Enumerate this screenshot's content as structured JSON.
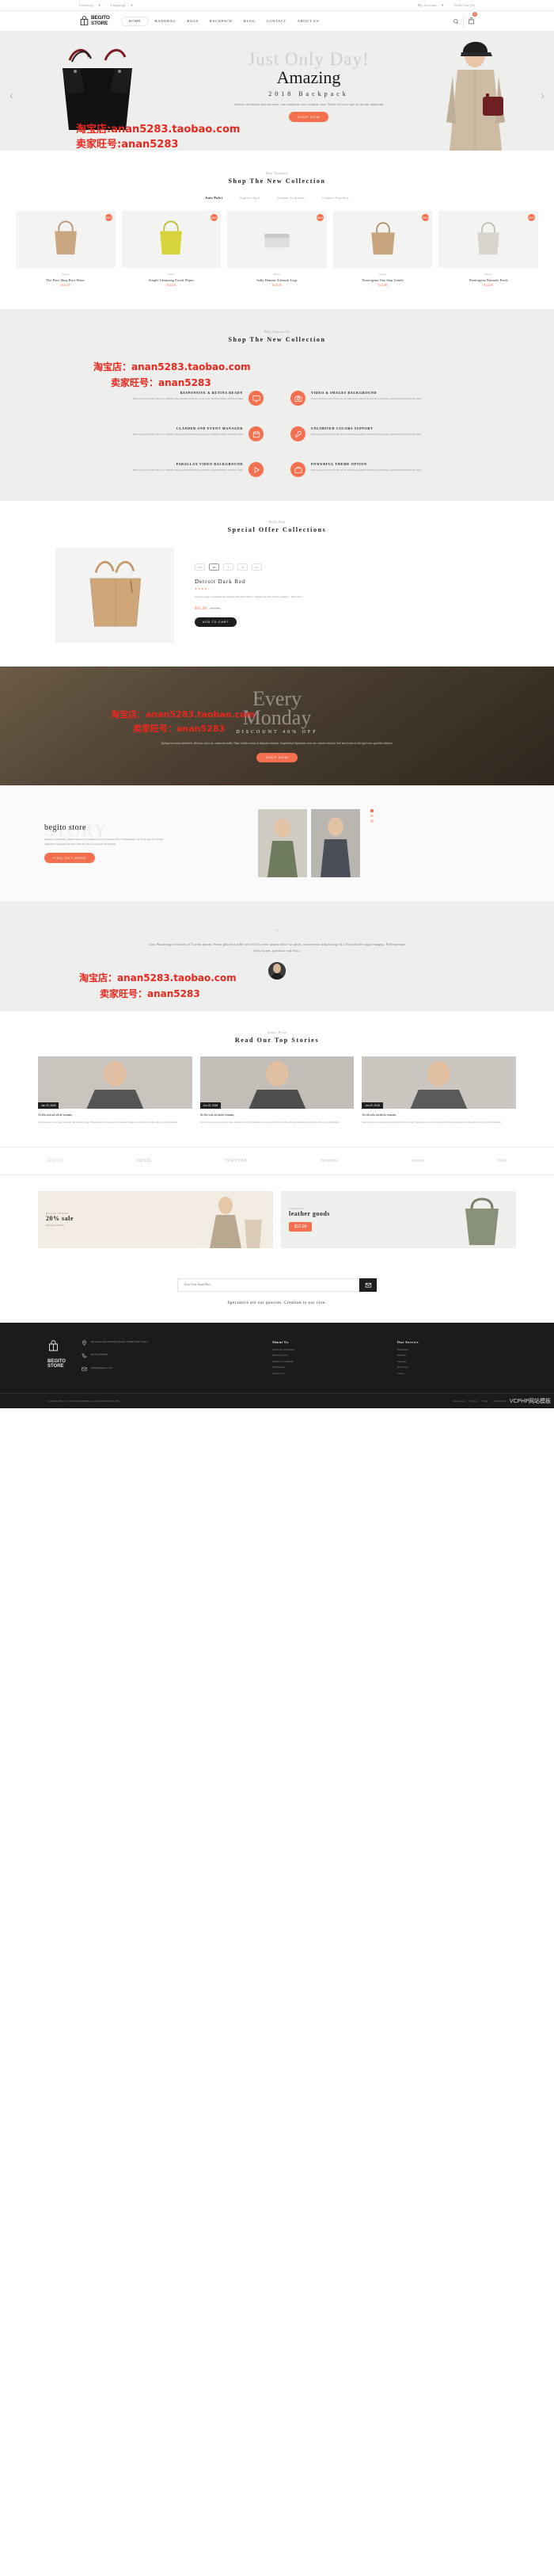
{
  "topbar": {
    "currency": "Currency",
    "language": "Language",
    "account": "My Account",
    "wishlist": "Wish List (0)"
  },
  "header": {
    "logo_line1": "BEGITO",
    "logo_line2": "STORE",
    "nav": [
      {
        "label": "HOME",
        "active": true
      },
      {
        "label": "HANDBAG",
        "active": false
      },
      {
        "label": "BAGS",
        "active": false
      },
      {
        "label": "BACKPACK",
        "active": false
      },
      {
        "label": "BLOG",
        "active": false
      },
      {
        "label": "CONTACT",
        "active": false
      },
      {
        "label": "ABOUT US",
        "active": false
      }
    ],
    "cart_count": "0"
  },
  "hero": {
    "line1": "Just Only Day!",
    "line2": "Amazing",
    "line3": "2018  Backpack",
    "desc": "Aenean vestibulum pretium enim, non commodo arcu volutpat vitae. Nulla vel lacus eget ex dictum dignissim",
    "button": "SHOP NOW",
    "prev": "‹",
    "next": "›"
  },
  "products": {
    "subtitle": "New Products",
    "title": "Shop The New Collection",
    "filters": [
      {
        "label": "Ante Pulvi",
        "active": true
      },
      {
        "label": "Sagittis Eget",
        "active": false
      },
      {
        "label": "Semper Vulputate",
        "active": false
      },
      {
        "label": "Congue Faucibus",
        "active": false
      }
    ],
    "items": [
      {
        "badge": "SALE",
        "category": "Beatae",
        "name": "The Face Shop Rice Water",
        "price": "$122.00"
      },
      {
        "badge": "SALE",
        "category": "Beatae",
        "name": "Simple Cleansing Facial Wipes",
        "price": "$122.00"
      },
      {
        "badge": "SALE",
        "category": "Beatae",
        "name": "Sally Hansen Airbrush Legs",
        "price": "$122.00"
      },
      {
        "badge": "SALE",
        "category": "Beatae",
        "name": "Neutrogena One Step Gentle",
        "price": "$122.00"
      },
      {
        "badge": "SALE",
        "category": "Beatae",
        "name": "Neutrogena Naturals Fresh",
        "price": "$122.00"
      }
    ]
  },
  "why": {
    "subtitle": "Why Choose Us",
    "title": "Shop The New Collection",
    "desc_common": "Fusce gravida tortor felis. Ac dictum risus sagittis id morbi porm justo eleifend libero ultricies amet",
    "features": [
      {
        "title": "RESPONSIVE & RETINA READY",
        "icon": "monitor-icon"
      },
      {
        "title": "VIDEO & IMAGES BACKGROUND",
        "icon": "camera-icon"
      },
      {
        "title": "CLANDER AND EVENT MANAGER",
        "icon": "calendar-icon"
      },
      {
        "title": "UNLIMITED COLORS SUPPORT",
        "icon": "wrench-icon"
      },
      {
        "title": "PARALLAX VIDEO BACKGROUND",
        "icon": "play-icon"
      },
      {
        "title": "POWERFUL THEME OPTION",
        "icon": "briefcase-icon"
      }
    ]
  },
  "offer": {
    "subtitle": "Hello Day",
    "title": "Special Offer Collections",
    "swatches": [
      {
        "label": "XXS",
        "active": false
      },
      {
        "label": "XS",
        "active": true
      },
      {
        "label": "S",
        "active": false
      },
      {
        "label": "M",
        "active": false
      },
      {
        "label": "XL",
        "active": false
      }
    ],
    "name": "Detroit Dark Red",
    "stars": "★★★★☆",
    "desc": "Cupid a purus venenatis dui sem $42.00 etiam that 's \"malesu lul sem fr416 consequ\" , dolor mi's...",
    "price": "$95.00",
    "old_price": "$125.00",
    "button": "ADD TO CART"
  },
  "discount": {
    "line1": "Every",
    "line2": "Monday",
    "headline": "DISCOUNT 40% OFF",
    "paragraph": "Quisque ut massa hendrerit, efficitur tortor eu, commodo nulla. Nam sodales metus in aliquam tristique. Suspendisse dignissim risus nec rutrum vehicula. Sed non lorem ut elit eget tortor gravida ultricies.",
    "button": "SHOP NOW"
  },
  "story": {
    "ghost": "STORY",
    "heading": "begito store",
    "paragraph": "Aenean vestibulum pretium enim, non commodo arcu volutpat vitae. Pellentesque vel lacus eget ex dictum dignissim. Quisque faucibus sedd sit amet lectus gravida blandit.",
    "button": "FIND OUT MORE"
  },
  "testimonial": {
    "quote": "Cras Pharetrago vertium of Lorem ipsum. Proin pharetra nibh vel velit.Lorem ipsum dolor sit amet, consectetur adipiscing elit. In molestie augue magna. Pellentesque felis lorem, pulvinar sed felis.",
    "avatar": "customer-avatar"
  },
  "blog": {
    "subtitle": "Latest Posts",
    "title": "Read Our Top Stories",
    "posts": [
      {
        "date": "Jun 22, 2018",
        "title": "At elit sola ad alicla veniam,",
        "excerpt": "Sedo nostrud proid qui, sit amet dui ultrices cing. Pellentes ut loss sed in brice habitat magna lacusm tide sit ami vitis gravida blandit."
      },
      {
        "date": "Jun 22, 2018",
        "title": "At elit sola ad alicla veniam,",
        "excerpt": "Sedo nostrud proid qui, sit amet dui ultrices cing. Pellentes ut loss sed in brice habitat magna lacusm tide sit ami vitis gravida blandit."
      },
      {
        "date": "Jun 22, 2018",
        "title": "At elit sola ad alicla veniam,",
        "excerpt": "Sedo nostrud proid qui, sit amet dui ultrices cing. Pellentes ut loss sed in brice habitat magna lacusm tide sit ami vitis gravida blandit."
      }
    ]
  },
  "brands": [
    "GUCCI",
    "DIESEL",
    "FOREVER",
    "Wordtree",
    "envato",
    "Oath"
  ],
  "promos": {
    "left": {
      "small": "BLACK FRIDAY",
      "big": "20% sale",
      "sub": "ON ALL ITEMS"
    },
    "right": {
      "small": "want more?",
      "big": "leather goods",
      "tag": "$12.09"
    }
  },
  "newsletter": {
    "placeholder": "Enter Your Email Here...",
    "tagline": "Spectators are our passion. Creation is our core."
  },
  "footer": {
    "logo_line1": "BEGITO",
    "logo_line2": "STORE",
    "address": "42 avenue des Champs Elysées 75000 Paris France",
    "phone": "(0123) 456789",
    "email": "demo@begito.com",
    "columns": [
      {
        "heading": "About Us",
        "links": [
          "Terms & Conditions",
          "Privacy Policy",
          "Terms of Condition",
          "Information",
          "Contact Us"
        ]
      },
      {
        "heading": "Our Service",
        "links": [
          "Deliveries",
          "Wishlist",
          "Specials",
          "New Item",
          "Stores"
        ]
      }
    ],
    "copyright": "COPYRIGHT © 2018 PLAZATHEMES. ALL RIGHT RESERVED.",
    "payments": [
      "MasterCard",
      "PayPal",
      "VISA",
      "AMERICAN"
    ]
  },
  "watermarks": {
    "hero1": "淘宝店:anan5283.taobao.com",
    "hero2": "卖家旺号:anan5283",
    "why1": "淘宝店：anan5283.taobao.com",
    "why2": "卖家旺号：anan5283",
    "disc1": "淘宝店：anan5283.taobao.com",
    "disc2": "卖家旺号：anan5283",
    "testi1": "淘宝店：anan5283.taobao.com",
    "testi2": "卖家旺号：anan5283",
    "corner": "VCPHP网站模板"
  },
  "colors": {
    "accent": "#f4704f",
    "dark": "#1b1b1b",
    "bg_grey": "#eeeeec"
  }
}
